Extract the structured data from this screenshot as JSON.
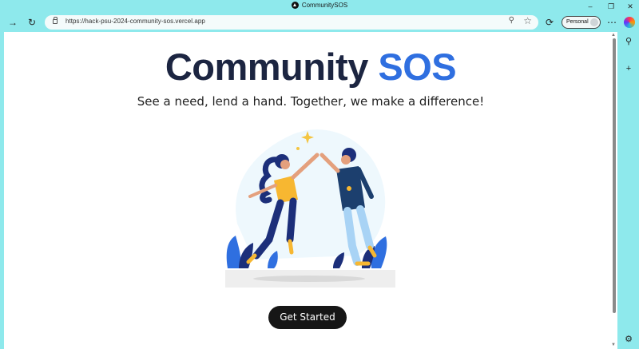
{
  "window": {
    "title": "CommunitySOS"
  },
  "toolbar": {
    "url": "https://hack-psu-2024-community-sos.vercel.app",
    "profile_label": "Personal",
    "icons": [
      "forward-icon",
      "refresh-icon",
      "lock-icon",
      "zoom-icon",
      "favorite-star-icon",
      "extensions-icon",
      "more-icon",
      "copilot-icon"
    ]
  },
  "side_rail": {
    "icons": [
      "search-icon",
      "add-icon",
      "settings-icon"
    ]
  },
  "hero": {
    "title_main": "Community",
    "title_accent": "SOS",
    "tagline": "See a need, lend a hand. Together, we make a difference!",
    "cta_label": "Get Started",
    "illustration": "two-people-high-five",
    "colors": {
      "title": "#1c2541",
      "accent": "#2f6fe0",
      "cta_bg": "#161616",
      "chrome": "#8ee9ec"
    }
  }
}
